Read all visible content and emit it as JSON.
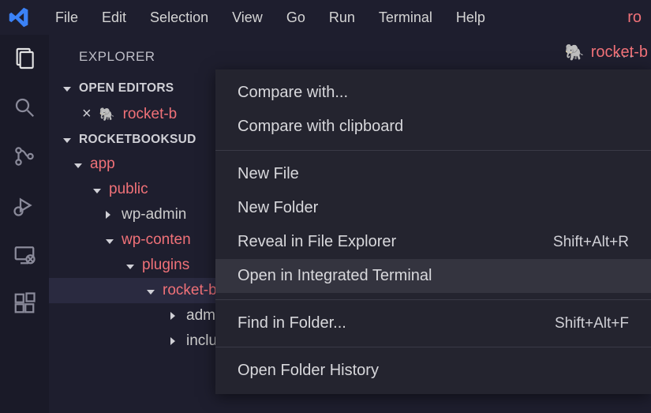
{
  "menubar": [
    "File",
    "Edit",
    "Selection",
    "View",
    "Go",
    "Run",
    "Terminal",
    "Help"
  ],
  "truncated_right": "ro",
  "sidebar": {
    "title": "EXPLORER",
    "open_editors_label": "OPEN EDITORS",
    "open_editor_item": "rocket-b",
    "workspace_label": "ROCKETBOOKSUD",
    "tree": {
      "app": "app",
      "public": "public",
      "wp_admin": "wp-admin",
      "wp_content": "wp-conten",
      "plugins": "plugins",
      "rocket_b": "rocket-b",
      "admin": "admin",
      "include": "include"
    }
  },
  "editor_tab_partial": "rocket-b",
  "context_menu": {
    "compare_with": "Compare with...",
    "compare_clipboard": "Compare with clipboard",
    "new_file": "New File",
    "new_folder": "New Folder",
    "reveal": "Reveal in File Explorer",
    "reveal_shortcut": "Shift+Alt+R",
    "open_terminal": "Open in Integrated Terminal",
    "find_in_folder": "Find in Folder...",
    "find_shortcut": "Shift+Alt+F",
    "open_folder_history": "Open Folder History"
  }
}
